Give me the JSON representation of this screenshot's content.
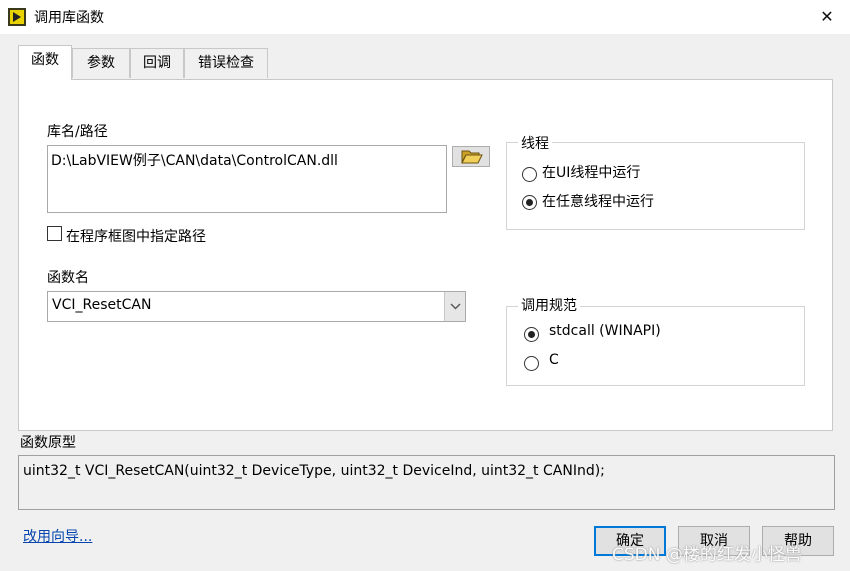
{
  "window": {
    "title": "调用库函数",
    "close_icon": "close-icon"
  },
  "tabs": [
    {
      "label": "函数",
      "active": true
    },
    {
      "label": "参数",
      "active": false
    },
    {
      "label": "回调",
      "active": false
    },
    {
      "label": "错误检查",
      "active": false
    }
  ],
  "library": {
    "label": "库名/路径",
    "path": "D:\\LabVIEW例子\\CAN\\data\\ControlCAN.dll",
    "browse_icon": "folder-open-icon"
  },
  "specify_path": {
    "label": "在程序框图中指定路径",
    "checked": false
  },
  "function": {
    "label": "函数名",
    "value": "VCI_ResetCAN"
  },
  "thread": {
    "title": "线程",
    "options": [
      {
        "label": "在UI线程中运行",
        "selected": false
      },
      {
        "label": "在任意线程中运行",
        "selected": true
      }
    ]
  },
  "calling_convention": {
    "title": "调用规范",
    "options": [
      {
        "label": "stdcall (WINAPI)",
        "selected": true
      },
      {
        "label": "C",
        "selected": false
      }
    ]
  },
  "prototype": {
    "label": "函数原型",
    "text": "uint32_t VCI_ResetCAN(uint32_t DeviceType, uint32_t DeviceInd, uint32_t CANInd);"
  },
  "footer": {
    "wizard_link": "改用向导...",
    "ok_label": "确定",
    "cancel_label": "取消",
    "help_label": "帮助"
  },
  "watermark": "CSDN @楼的红发小怪兽"
}
